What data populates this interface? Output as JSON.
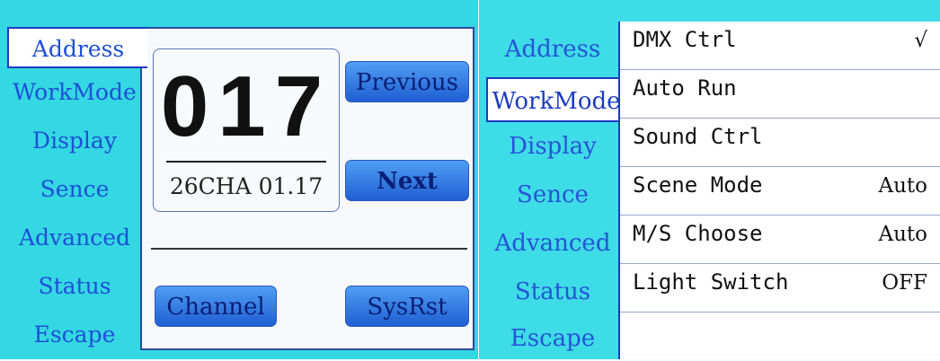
{
  "left": {
    "menu": [
      "Address",
      "WorkMode",
      "Display",
      "Sence",
      "Advanced",
      "Status",
      "Escape"
    ],
    "address_value": "017",
    "channel_info": "26CHA 01.17",
    "buttons": {
      "previous": "Previous",
      "next": "Next",
      "channel": "Channel",
      "sysrst": "SysRst"
    }
  },
  "right": {
    "menu": [
      "Address",
      "WorkMode",
      "Display",
      "Sence",
      "Advanced",
      "Status",
      "Escape"
    ],
    "options": [
      {
        "label": "DMX Ctrl",
        "value": "√"
      },
      {
        "label": "Auto Run",
        "value": ""
      },
      {
        "label": "Sound Ctrl",
        "value": ""
      },
      {
        "label": "Scene Mode",
        "value": "Auto"
      },
      {
        "label": "M/S Choose",
        "value": "Auto"
      },
      {
        "label": "Light Switch",
        "value": "OFF"
      }
    ]
  },
  "colors": {
    "screen_background": "#33d8e3",
    "menu_text": "#1f4fd6",
    "button_fill": "#3a7fe6"
  }
}
